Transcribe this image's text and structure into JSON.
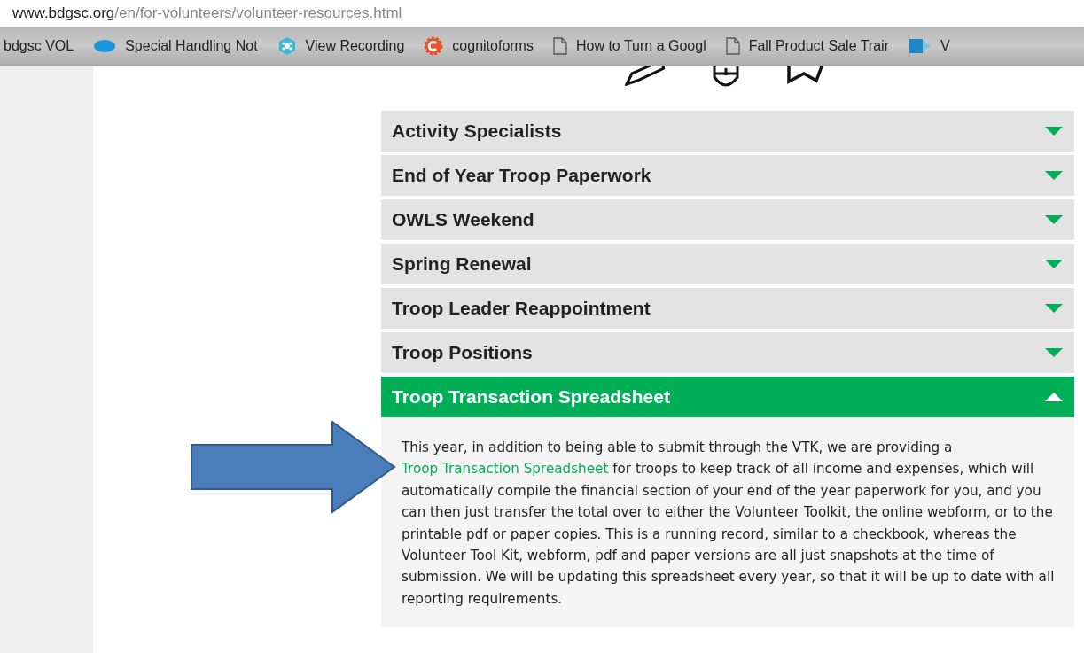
{
  "address_bar": {
    "domain": "www.bdgsc.org",
    "path": "/en/for-volunteers/volunteer-resources.html"
  },
  "bookmarks": [
    {
      "label": "bdgsc VOL",
      "kind": "none"
    },
    {
      "label": "Special Handling Not",
      "kind": "cloud"
    },
    {
      "label": "View Recording",
      "kind": "hexagon"
    },
    {
      "label": "cognitoforms",
      "kind": "cog"
    },
    {
      "label": "How to Turn a Googl",
      "kind": "page"
    },
    {
      "label": "Fall Product Sale Trair",
      "kind": "page"
    },
    {
      "label": "V",
      "kind": "sharepoint"
    }
  ],
  "accordion": [
    {
      "label": "Activity Specialists",
      "expanded": false
    },
    {
      "label": "End of Year Troop Paperwork",
      "expanded": false
    },
    {
      "label": "OWLS Weekend",
      "expanded": false
    },
    {
      "label": "Spring Renewal",
      "expanded": false
    },
    {
      "label": "Troop Leader Reappointment",
      "expanded": false
    },
    {
      "label": "Troop Positions",
      "expanded": false
    },
    {
      "label": "Troop Transaction Spreadsheet",
      "expanded": true,
      "content": {
        "text_before": "This year, in addition to being able to submit through the VTK, we are providing a ",
        "link": "Troop Transaction Spreadsheet",
        "text_after": " for troops to keep track of all income and expenses, which will automatically compile the financial section of your end of the year paperwork for you, and you can then just transfer the total over to either the Volunteer Toolkit, the online webform, or to the printable pdf or paper copies. This is a running record, similar to a checkbook, whereas the Volunteer Tool Kit, webform, pdf and paper versions are all just snapshots at the time of submission. We will be updating this spreadsheet every year, so that it will be up to date with all reporting requirements."
      }
    }
  ]
}
